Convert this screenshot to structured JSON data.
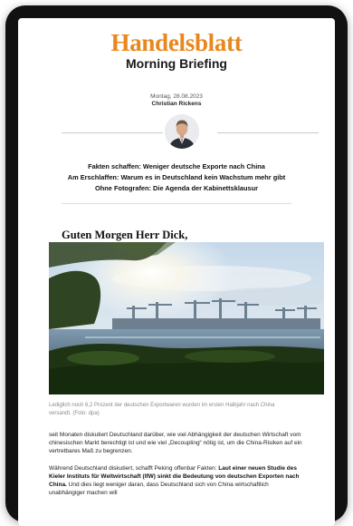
{
  "brand": {
    "name": "Handelsblatt",
    "product": "Morning Briefing",
    "accent_color": "#e8871e"
  },
  "meta": {
    "date": "Montag, 28.08.2023",
    "author": "Christian Rickens"
  },
  "headlines": [
    "Fakten schaffen: Weniger deutsche Exporte nach China",
    "Am Erschlaffen: Warum es in Deutschland kein Wachstum mehr gibt",
    "Ohne Fotografen: Die Agenda der Kabinettsklausur"
  ],
  "greeting": "Guten Morgen Herr Dick,",
  "photo": {
    "caption": "Lediglich noch 6,2 Prozent der deutschen Exportwaren wurden im ersten Halbjahr nach China versandt. (Foto: dpa)"
  },
  "body": {
    "p1": "seit Monaten diskutiert Deutschland darüber, wie viel Abhängigkeit der deutschen Wirtschaft vom chinesischen Markt berechtigt ist und wie viel „Decoupling“ nötig ist, um die China-Risiken auf ein vertretbares Maß zu begrenzen.",
    "p2_start": "Während Deutschland diskutiert, schafft Peking offenbar Fakten: ",
    "p2_bold": "Laut einer neuen Studie des Kieler Instituts für Weltwirtschaft (IfW) sinkt die Bedeutung von deutschen Exporten nach China.",
    "p2_end": " Und dies liegt weniger daran, dass Deutschland sich von China wirtschaftlich unabhängiger machen will"
  }
}
